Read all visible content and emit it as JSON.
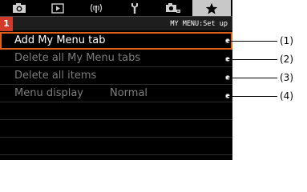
{
  "tabs": [
    {
      "icon": "camera-icon"
    },
    {
      "icon": "playback-icon"
    },
    {
      "icon": "wireless-icon"
    },
    {
      "icon": "wrench-icon"
    },
    {
      "icon": "custom-function-icon"
    },
    {
      "icon": "star-icon",
      "active": true
    }
  ],
  "header": {
    "page_number": "1",
    "title": "MY MENU:Set up"
  },
  "menu": {
    "items": [
      {
        "label": "Add My Menu tab",
        "value": ""
      },
      {
        "label": "Delete all My Menu tabs",
        "value": ""
      },
      {
        "label": "Delete all items",
        "value": ""
      },
      {
        "label": "Menu display",
        "value": "Normal"
      }
    ]
  },
  "callouts": [
    "(1)",
    "(2)",
    "(3)",
    "(4)"
  ],
  "colors": {
    "accent": "#e06018",
    "active_tab": "#c8c8c8",
    "page_badge": "#d23a2a",
    "disabled_text": "#7d7d7d"
  }
}
